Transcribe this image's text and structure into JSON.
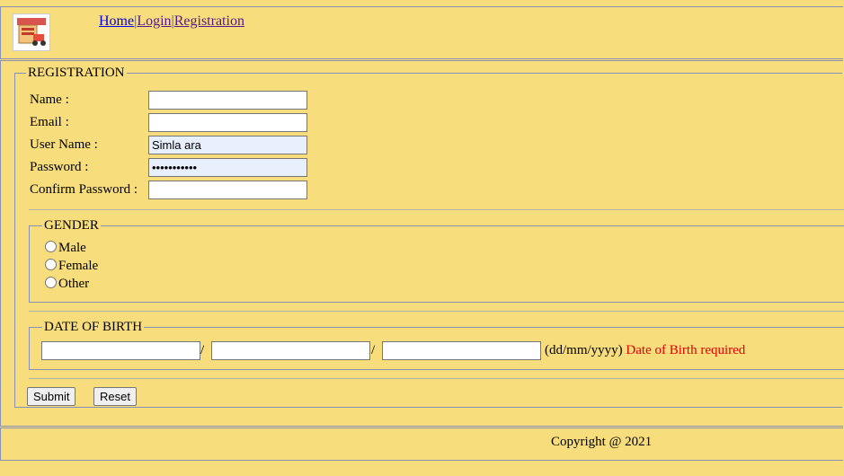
{
  "header": {
    "logo": "shop-logo",
    "nav": {
      "home": "Home",
      "login": "Login",
      "registration": "Registration",
      "separator": "|"
    }
  },
  "registration": {
    "legend": "REGISTRATION",
    "fields": {
      "name": {
        "label": "Name :",
        "value": ""
      },
      "email": {
        "label": "Email :",
        "value": ""
      },
      "username": {
        "label": "User Name :",
        "value": "Simla ara"
      },
      "password": {
        "label": "Password :",
        "value": "•••••••••••"
      },
      "confirm": {
        "label": "Confirm Password :",
        "value": ""
      }
    },
    "gender": {
      "legend": "GENDER",
      "options": [
        "Male",
        "Female",
        "Other"
      ]
    },
    "dob": {
      "legend": "DATE OF BIRTH",
      "separator": "/",
      "format": "(dd/mm/yyyy)",
      "error": "Date of Birth required"
    },
    "buttons": {
      "submit": "Submit",
      "reset": "Reset"
    }
  },
  "footer": {
    "copyright": "Copyright @ 2021"
  },
  "colors": {
    "background": "#f8dd7d",
    "error": "#e00000",
    "link": "#0000ee",
    "visited_link": "#551a8b"
  }
}
